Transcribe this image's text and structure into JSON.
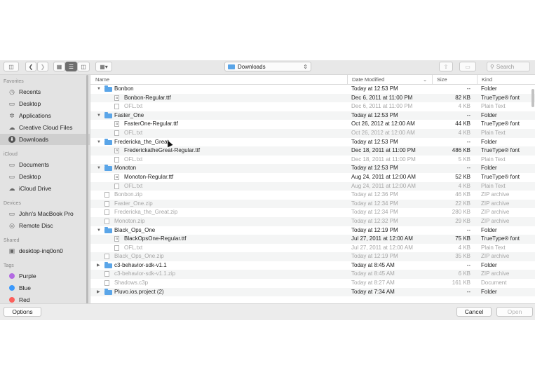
{
  "toolbar": {
    "location": "Downloads",
    "search_placeholder": "Search"
  },
  "sidebar": {
    "favorites_header": "Favorites",
    "favorites": [
      {
        "label": "Recents",
        "icon": "clock-icon"
      },
      {
        "label": "Desktop",
        "icon": "desktop-folder-icon"
      },
      {
        "label": "Applications",
        "icon": "applications-icon"
      },
      {
        "label": "Creative Cloud Files",
        "icon": "creative-cloud-icon"
      },
      {
        "label": "Downloads",
        "icon": "downloads-icon",
        "selected": true
      }
    ],
    "icloud_header": "iCloud",
    "icloud": [
      {
        "label": "Documents",
        "icon": "documents-icon"
      },
      {
        "label": "Desktop",
        "icon": "desktop-folder-icon"
      },
      {
        "label": "iCloud Drive",
        "icon": "cloud-icon"
      }
    ],
    "devices_header": "Devices",
    "devices": [
      {
        "label": "John's MacBook Pro",
        "icon": "laptop-icon"
      },
      {
        "label": "Remote Disc",
        "icon": "disc-icon"
      }
    ],
    "shared_header": "Shared",
    "shared": [
      {
        "label": "desktop-inq0on0",
        "icon": "computer-icon"
      }
    ],
    "tags_header": "Tags",
    "tags": [
      {
        "label": "Purple",
        "color": "#b36ae2"
      },
      {
        "label": "Blue",
        "color": "#3b99fc"
      },
      {
        "label": "Red",
        "color": "#fc605c"
      }
    ]
  },
  "columns": {
    "name": "Name",
    "date": "Date Modified",
    "size": "Size",
    "kind": "Kind"
  },
  "files": [
    {
      "name": "Bonbon",
      "date": "Today at 12:53 PM",
      "size": "--",
      "kind": "Folder",
      "type": "folder",
      "level": 0,
      "expanded": true,
      "dim": false
    },
    {
      "name": "Bonbon-Regular.ttf",
      "date": "Dec 6, 2011 at 11:00 PM",
      "size": "82 KB",
      "kind": "TrueType® font",
      "type": "font",
      "level": 1,
      "dim": false
    },
    {
      "name": "OFL.txt",
      "date": "Dec 6, 2011 at 11:00 PM",
      "size": "4 KB",
      "kind": "Plain Text",
      "type": "doc",
      "level": 1,
      "dim": true
    },
    {
      "name": "Faster_One",
      "date": "Today at 12:53 PM",
      "size": "--",
      "kind": "Folder",
      "type": "folder",
      "level": 0,
      "expanded": true,
      "dim": false
    },
    {
      "name": "FasterOne-Regular.ttf",
      "date": "Oct 26, 2012 at 12:00 AM",
      "size": "44 KB",
      "kind": "TrueType® font",
      "type": "font",
      "level": 1,
      "dim": false
    },
    {
      "name": "OFL.txt",
      "date": "Oct 26, 2012 at 12:00 AM",
      "size": "4 KB",
      "kind": "Plain Text",
      "type": "doc",
      "level": 1,
      "dim": true
    },
    {
      "name": "Fredericka_the_Great",
      "date": "Today at 12:53 PM",
      "size": "--",
      "kind": "Folder",
      "type": "folder",
      "level": 0,
      "expanded": true,
      "dim": false
    },
    {
      "name": "FrederickatheGreat-Regular.ttf",
      "date": "Dec 18, 2011 at 11:00 PM",
      "size": "486 KB",
      "kind": "TrueType® font",
      "type": "font",
      "level": 1,
      "dim": false
    },
    {
      "name": "OFL.txt",
      "date": "Dec 18, 2011 at 11:00 PM",
      "size": "5 KB",
      "kind": "Plain Text",
      "type": "doc",
      "level": 1,
      "dim": true
    },
    {
      "name": "Monoton",
      "date": "Today at 12:53 PM",
      "size": "--",
      "kind": "Folder",
      "type": "folder",
      "level": 0,
      "expanded": true,
      "dim": false
    },
    {
      "name": "Monoton-Regular.ttf",
      "date": "Aug 24, 2011 at 12:00 AM",
      "size": "52 KB",
      "kind": "TrueType® font",
      "type": "font",
      "level": 1,
      "dim": false
    },
    {
      "name": "OFL.txt",
      "date": "Aug 24, 2011 at 12:00 AM",
      "size": "4 KB",
      "kind": "Plain Text",
      "type": "doc",
      "level": 1,
      "dim": true
    },
    {
      "name": "Bonbon.zip",
      "date": "Today at 12:36 PM",
      "size": "46 KB",
      "kind": "ZIP archive",
      "type": "zip",
      "level": 0,
      "dim": true
    },
    {
      "name": "Faster_One.zip",
      "date": "Today at 12:34 PM",
      "size": "22 KB",
      "kind": "ZIP archive",
      "type": "zip",
      "level": 0,
      "dim": true
    },
    {
      "name": "Fredericka_the_Great.zip",
      "date": "Today at 12:34 PM",
      "size": "280 KB",
      "kind": "ZIP archive",
      "type": "zip",
      "level": 0,
      "dim": true
    },
    {
      "name": "Monoton.zip",
      "date": "Today at 12:32 PM",
      "size": "29 KB",
      "kind": "ZIP archive",
      "type": "zip",
      "level": 0,
      "dim": true
    },
    {
      "name": "Black_Ops_One",
      "date": "Today at 12:19 PM",
      "size": "--",
      "kind": "Folder",
      "type": "folder",
      "level": 0,
      "expanded": true,
      "dim": false
    },
    {
      "name": "BlackOpsOne-Regular.ttf",
      "date": "Jul 27, 2011 at 12:00 AM",
      "size": "75 KB",
      "kind": "TrueType® font",
      "type": "font",
      "level": 1,
      "dim": false
    },
    {
      "name": "OFL.txt",
      "date": "Jul 27, 2011 at 12:00 AM",
      "size": "4 KB",
      "kind": "Plain Text",
      "type": "doc",
      "level": 1,
      "dim": true
    },
    {
      "name": "Black_Ops_One.zip",
      "date": "Today at 12:19 PM",
      "size": "35 KB",
      "kind": "ZIP archive",
      "type": "zip",
      "level": 0,
      "dim": true
    },
    {
      "name": "c3-behavior-sdk-v1.1",
      "date": "Today at 8:45 AM",
      "size": "--",
      "kind": "Folder",
      "type": "folder",
      "level": 0,
      "expanded": false,
      "dim": false
    },
    {
      "name": "c3-behavior-sdk-v1.1.zip",
      "date": "Today at 8:45 AM",
      "size": "6 KB",
      "kind": "ZIP archive",
      "type": "zip",
      "level": 0,
      "dim": true
    },
    {
      "name": "Shadows.c3p",
      "date": "Today at 8:27 AM",
      "size": "161 KB",
      "kind": "Document",
      "type": "doc",
      "level": 0,
      "dim": true
    },
    {
      "name": "Pluvo.ios.project (2)",
      "date": "Today at 7:34 AM",
      "size": "--",
      "kind": "Folder",
      "type": "folder",
      "level": 0,
      "expanded": false,
      "dim": false
    }
  ],
  "footer": {
    "options_label": "Options",
    "cancel_label": "Cancel",
    "open_label": "Open"
  }
}
